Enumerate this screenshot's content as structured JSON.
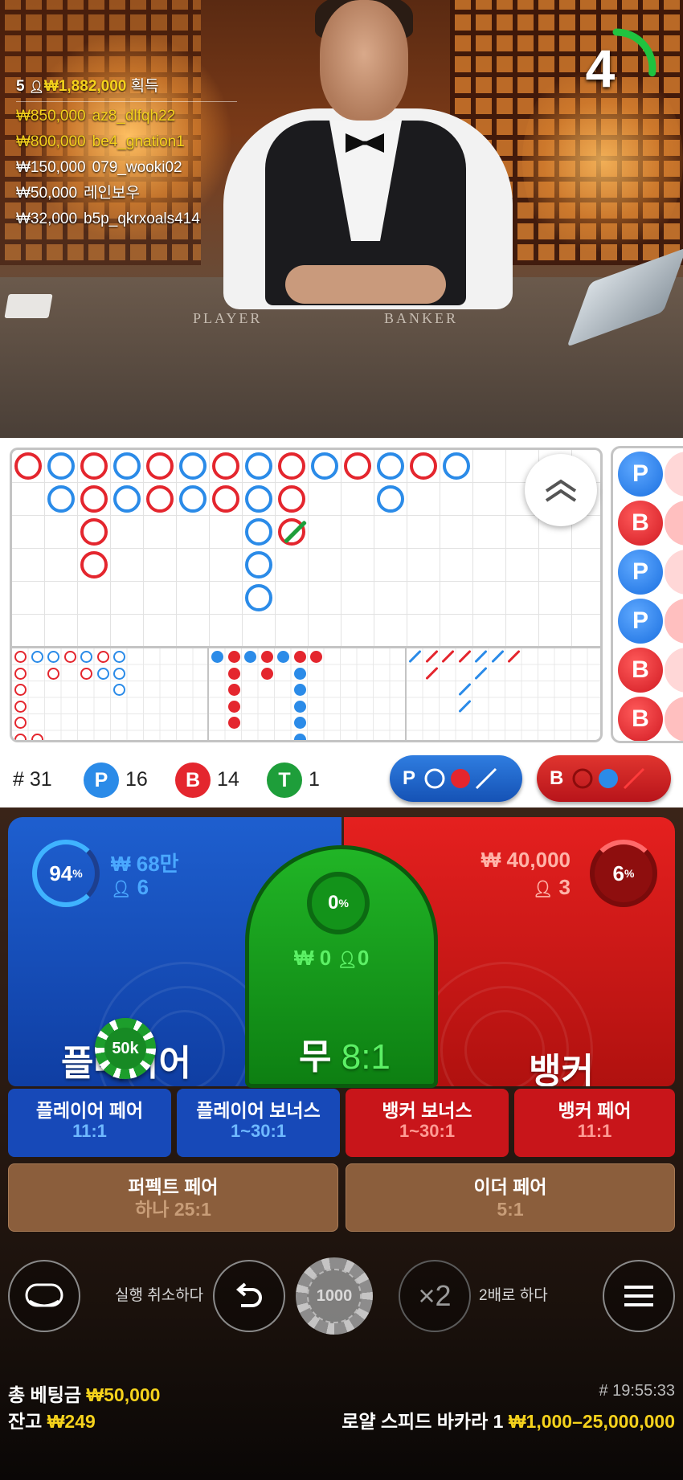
{
  "winners": {
    "count": "5",
    "total": "₩1,882,000",
    "label": "획득",
    "list": [
      {
        "amount": "₩850,000",
        "name": "az8_dlfqh22",
        "highlight": true
      },
      {
        "amount": "₩800,000",
        "name": "be4_gnation1",
        "highlight": true
      },
      {
        "amount": "₩150,000",
        "name": "079_wooki02",
        "highlight": false
      },
      {
        "amount": "₩50,000",
        "name": "레인보우",
        "highlight": false
      },
      {
        "amount": "₩32,000",
        "name": "b5p_qkrxoals414",
        "highlight": false
      }
    ]
  },
  "timer": {
    "seconds": "4",
    "fraction_remaining": 0.27
  },
  "table_felt": {
    "player": "PLAYER",
    "banker": "BANKER"
  },
  "stats": {
    "round_label": "# 31",
    "player": {
      "symbol": "P",
      "count": "16"
    },
    "banker": {
      "symbol": "B",
      "count": "14"
    },
    "tie": {
      "symbol": "T",
      "count": "1"
    },
    "predict_player": "P",
    "predict_banker": "B"
  },
  "bead_plate": [
    "P",
    "B",
    "P",
    "P",
    "B",
    "B"
  ],
  "main_bets": {
    "player": {
      "label": "플레이어",
      "percent": "94",
      "pct_sign": "%",
      "amount": "₩ 68만",
      "players": "6"
    },
    "tie": {
      "label": "무",
      "odds": "8:1",
      "percent": "0",
      "pct_sign": "%",
      "amount": "₩ 0",
      "players": "0"
    },
    "banker": {
      "label": "뱅커",
      "percent": "6",
      "pct_sign": "%",
      "amount": "₩ 40,000",
      "players": "3"
    }
  },
  "placed_chip": "50k",
  "side_bets": [
    {
      "label": "플레이어 페어",
      "odds": "11:1",
      "color": "#1749b8"
    },
    {
      "label": "플레이어 보너스",
      "odds": "1~30:1",
      "color": "#1749b8"
    },
    {
      "label": "뱅커 보너스",
      "odds": "1~30:1",
      "color": "#c8151a"
    },
    {
      "label": "뱅커 페어",
      "odds": "11:1",
      "color": "#c8151a"
    }
  ],
  "pair_bets": {
    "perfect": {
      "label": "퍼펙트 페어",
      "odds": "하나 25:1"
    },
    "either": {
      "label": "이더 페어",
      "odds": "5:1"
    }
  },
  "controls": {
    "undo_label": "실행 취소하다",
    "chip_value": "1000",
    "double_symbol": "×2",
    "double_label": "2배로 하다"
  },
  "footer": {
    "total_bet_label": "총 베팅금",
    "total_bet": "₩50,000",
    "balance_label": "잔고",
    "balance": "₩249",
    "time": "# 19:55:33",
    "table_name": "로얄 스피드 바카라 1",
    "limits": "₩1,000–25,000,000"
  },
  "colors": {
    "player": "#2b8be8",
    "banker": "#e4262e",
    "tie": "#1e9e3a",
    "gold": "#f5d21c"
  }
}
